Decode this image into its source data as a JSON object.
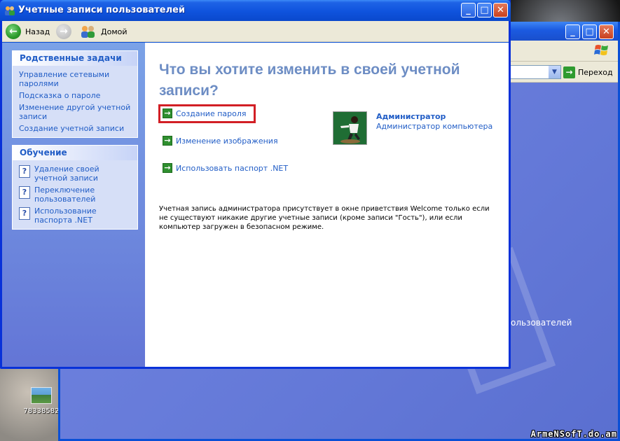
{
  "window": {
    "title": "Учетные записи пользователей",
    "buttons": {
      "minimize": "_",
      "maximize": "□",
      "close": "✕"
    }
  },
  "toolbar": {
    "back_label": "Назад",
    "home_label": "Домой"
  },
  "sidebar": {
    "related_tasks": {
      "title": "Родственные задачи",
      "items": [
        "Управление сетевыми паролями",
        "Подсказка о пароле",
        "Изменение другой учетной записи",
        "Создание учетной записи"
      ]
    },
    "learning": {
      "title": "Обучение",
      "items": [
        "Удаление своей учетной записи",
        "Переключение пользователей",
        "Использование паспорта .NET"
      ]
    }
  },
  "main": {
    "heading": "Что вы хотите изменить в своей учетной записи?",
    "options": [
      "Создание пароля",
      "Изменение изображения",
      "Использовать паспорт .NET"
    ],
    "account": {
      "name": "Администратор",
      "role": "Администратор компьютера"
    },
    "note": "Учетная запись администратора присутствует в окне приветствия Welcome только если не существуют никакие другие учетные записи (кроме записи \"Гость\"), или если компьютер загружен в безопасном режиме."
  },
  "background_window": {
    "go_label": "Переход",
    "partial_text": "ользователей"
  },
  "desktop": {
    "icon_caption": "78338582",
    "watermark": "ArmeNSofT.do.am"
  },
  "colors": {
    "titlebar": "#0a4fd6",
    "link": "#215dc6",
    "highlight": "#d21f25",
    "heading": "#6d8dc4"
  }
}
